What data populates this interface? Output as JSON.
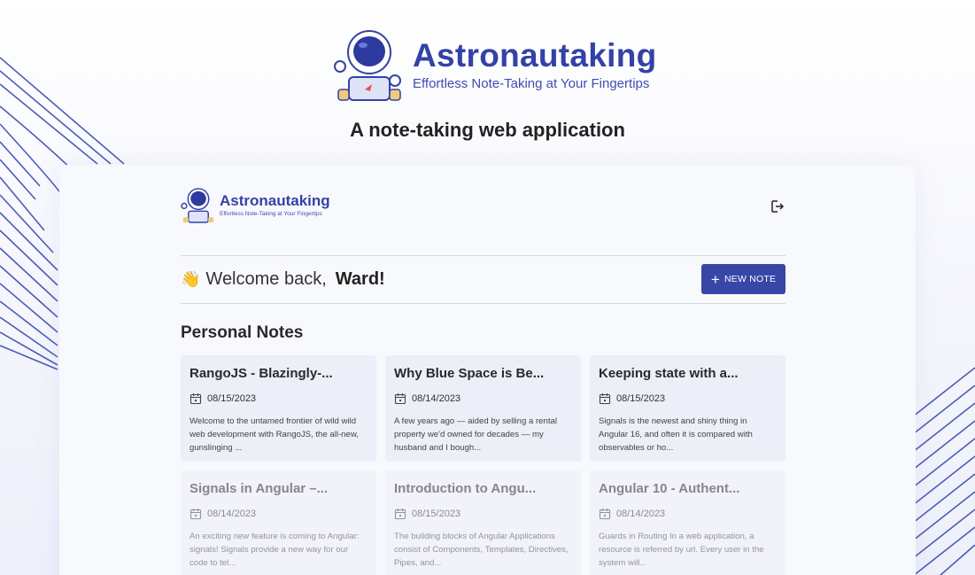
{
  "hero": {
    "brand_name": "Astronautaking",
    "tagline": "Effortless Note-Taking at Your Fingertips",
    "subtitle": "A note-taking web application"
  },
  "app": {
    "brand_name": "Astronautaking",
    "tagline": "Effortless Note-Taking at Your Fingertips",
    "logout_icon": "logout-icon",
    "welcome_prefix": "Welcome back,",
    "username": "Ward!",
    "wave_emoji": "👋",
    "new_note_label": "NEW NOTE",
    "section_title": "Personal Notes",
    "notes": [
      {
        "title": "RangoJS - Blazingly-...",
        "date": "08/15/2023",
        "excerpt": "Welcome to the untamed frontier of wild wild web development with RangoJS, the all-new, gunslinging ..."
      },
      {
        "title": "Why Blue Space is Be...",
        "date": "08/14/2023",
        "excerpt": "A few years ago — aided by selling a rental property we'd owned for decades — my husband and I bough..."
      },
      {
        "title": "Keeping state with a...",
        "date": "08/15/2023",
        "excerpt": "Signals is the newest and shiny thing in Angular 16, and often it is compared with observables or ho..."
      },
      {
        "title": "Signals in Angular –...",
        "date": "08/14/2023",
        "excerpt": "An exciting new feature is coming to Angular: signals! Signals provide a new way for our code to tel..."
      },
      {
        "title": "Introduction to Angu...",
        "date": "08/15/2023",
        "excerpt": "The building blocks of Angular Applications consist of Components, Templates, Directives, Pipes, and..."
      },
      {
        "title": "Angular 10 - Authent...",
        "date": "08/14/2023",
        "excerpt": "Guards in Routing In a web application, a resource is referred by url. Every user in the system will..."
      }
    ]
  },
  "colors": {
    "brand": "#3342a6",
    "button": "#3846a8",
    "card": "#eceef8"
  }
}
